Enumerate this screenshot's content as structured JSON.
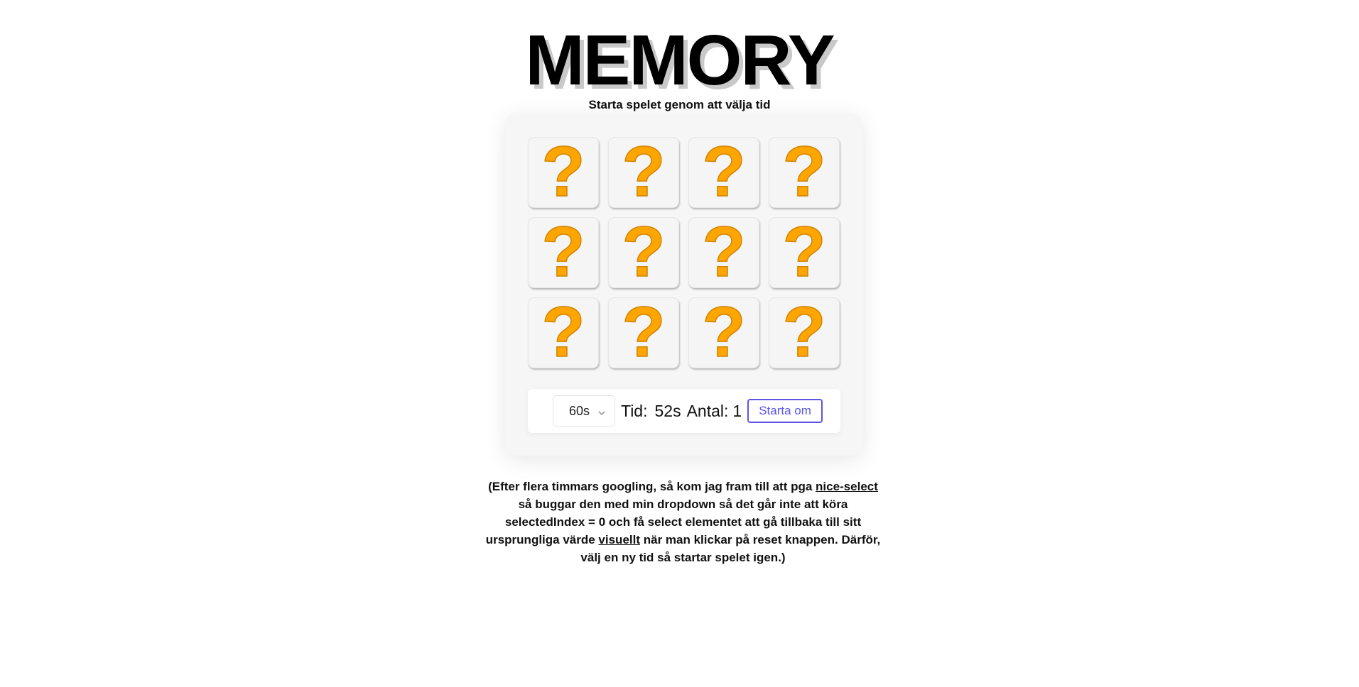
{
  "header": {
    "title": "MEMORY",
    "subtitle": "Starta spelet genom att välja tid"
  },
  "board": {
    "rows": 3,
    "columns": 4,
    "card_back_symbol": "?",
    "card_back_color": "#ffa500",
    "cards": [
      {
        "state": "hidden",
        "icon": "question-mark-icon"
      },
      {
        "state": "hidden",
        "icon": "question-mark-icon"
      },
      {
        "state": "hidden",
        "icon": "question-mark-icon"
      },
      {
        "state": "hidden",
        "icon": "question-mark-icon"
      },
      {
        "state": "hidden",
        "icon": "question-mark-icon"
      },
      {
        "state": "hidden",
        "icon": "question-mark-icon"
      },
      {
        "state": "hidden",
        "icon": "question-mark-icon"
      },
      {
        "state": "hidden",
        "icon": "question-mark-icon"
      },
      {
        "state": "hidden",
        "icon": "question-mark-icon"
      },
      {
        "state": "hidden",
        "icon": "question-mark-icon"
      },
      {
        "state": "hidden",
        "icon": "question-mark-icon"
      },
      {
        "state": "hidden",
        "icon": "question-mark-icon"
      }
    ]
  },
  "controls": {
    "time_select_value": "60s",
    "time_label": "Tid:",
    "time_value": "52s",
    "count_label": "Antal:",
    "count_value": "1",
    "restart_label": "Starta om",
    "accent_color": "#5b55e6"
  },
  "note": {
    "part1": "(Efter flera timmars googling, så kom jag fram till att pga ",
    "link1": "nice-select",
    "part2": " så buggar den med min dropdown så det går inte att köra selectedIndex = 0 och få select elementet att gå tillbaka till sitt ursprungliga värde ",
    "link2": "visuellt",
    "part3": " när man klickar på reset knappen. Därför, välj en ny tid så startar spelet igen.)"
  }
}
